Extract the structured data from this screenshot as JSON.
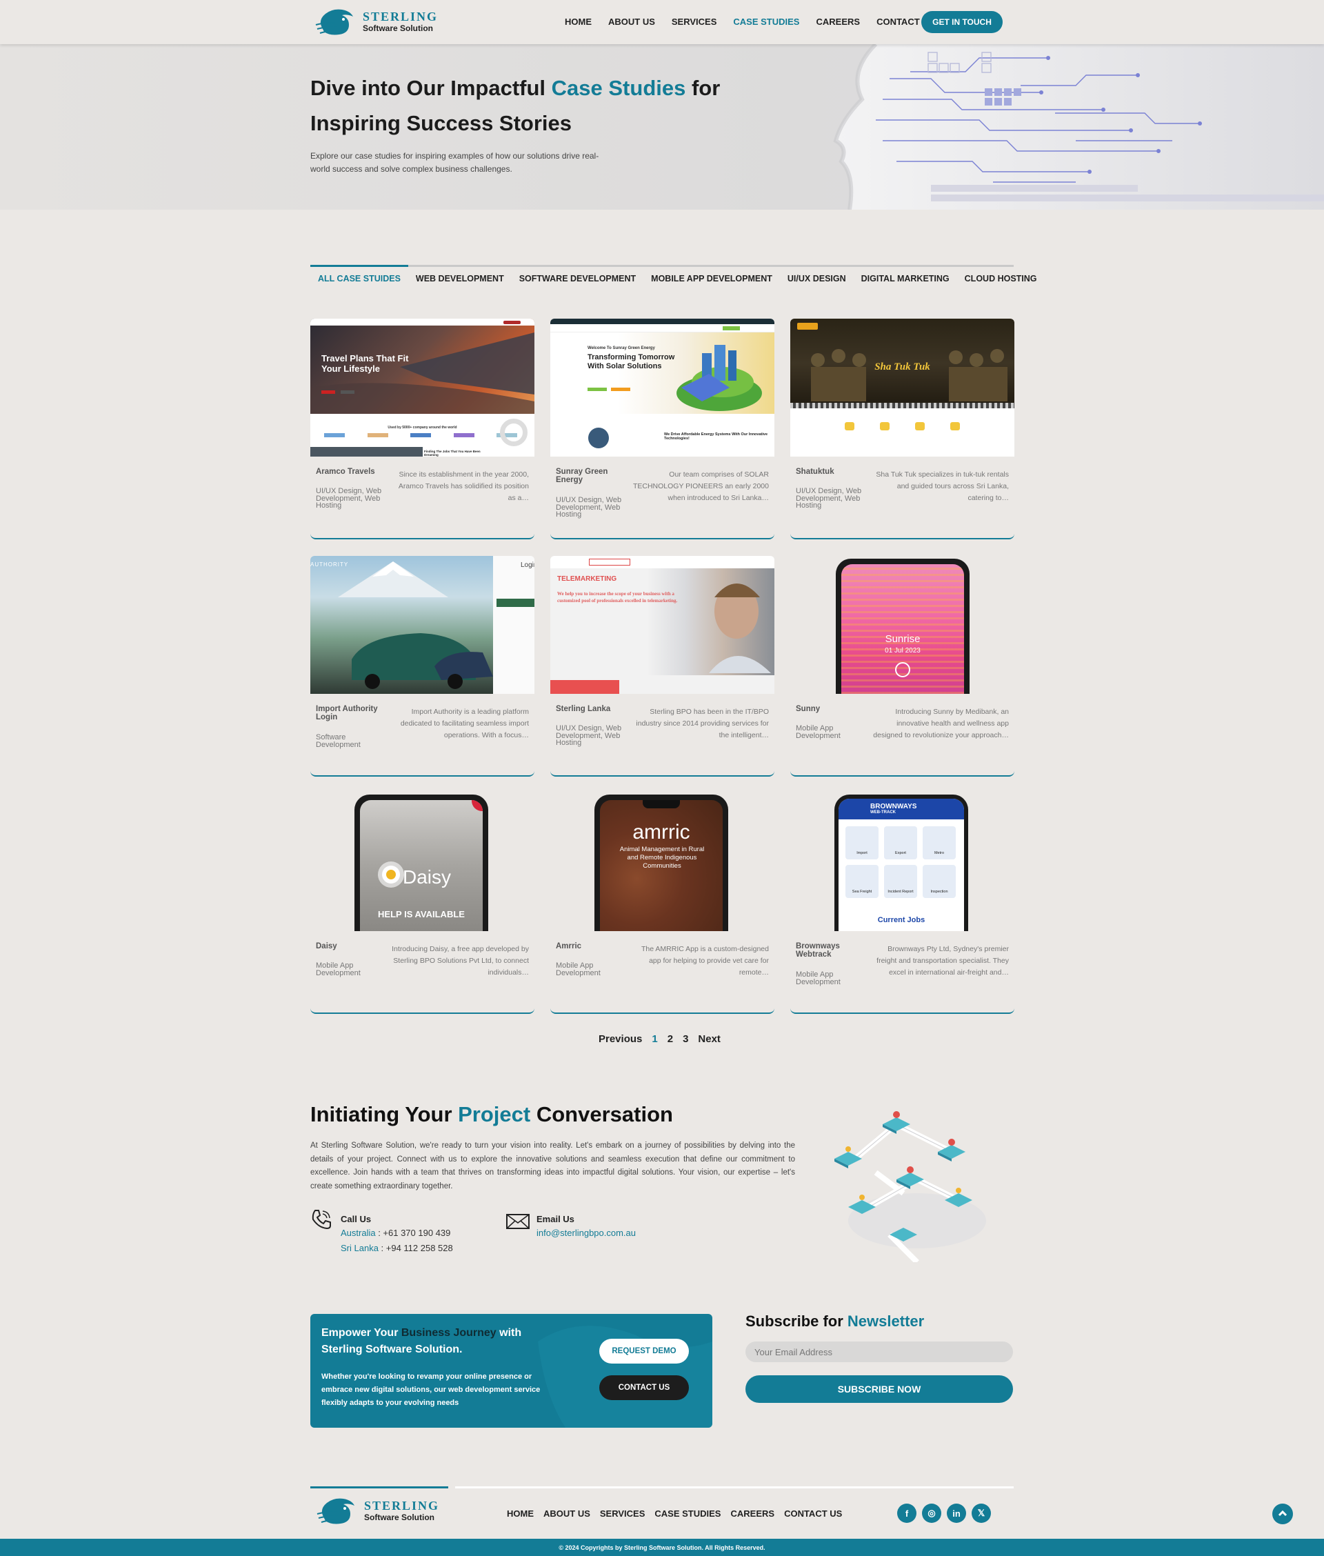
{
  "brand": {
    "name": "STERLING",
    "tagline": "Software Solution"
  },
  "nav": {
    "items": [
      "HOME",
      "ABOUT US",
      "SERVICES",
      "CASE STUDIES",
      "CAREERS",
      "CONTACT US"
    ],
    "active": "CASE STUDIES",
    "cta": "GET IN TOUCH"
  },
  "hero": {
    "title_a": "Dive into Our Impactful ",
    "title_hl": "Case Studies",
    "title_b": " for Inspiring Success Stories",
    "text": "Explore our case studies for inspiring examples of how our solutions drive real-world success and solve complex business challenges."
  },
  "tabs": [
    "ALL CASE STUIDES",
    "WEB DEVELOPMENT",
    "SOFTWARE DEVELOPMENT",
    "MOBILE APP DEVELOPMENT",
    "UI/UX DESIGN",
    "DIGITAL MARKETING",
    "CLOUD HOSTING"
  ],
  "cards": [
    {
      "title": "Aramco Travels",
      "tags": "UI/UX Design, Web Development, Web Hosting",
      "desc": "Since its establishment in the year 2000, Aramco Travels has solidified its position as a…",
      "thumb": {
        "headline": "Travel Plans That Fit Your Lifestyle",
        "sub": "Used by 5000+ company around the world",
        "caption": "Finding The Jobs That You Have Been Dreaming"
      }
    },
    {
      "title": "Sunray Green Energy",
      "tags": "UI/UX Design, Web Development, Web Hosting",
      "desc": "Our team comprises of SOLAR TECHNOLOGY PIONEERS an early 2000 when introduced to Sri Lanka…",
      "thumb": {
        "welcome": "Welcome To Sunray Green Energy",
        "headline": "Transforming Tomorrow With Solar Solutions",
        "caption": "We Drive Affordable Energy Systems With Our Innovative Technologies!"
      }
    },
    {
      "title": "Shatuktuk",
      "tags": "UI/UX Design, Web Development, Web Hosting",
      "desc": "Sha Tuk Tuk specializes in tuk-tuk rentals and guided tours across Sri Lanka, catering to…",
      "thumb": {
        "headline": "Sha Tuk Tuk"
      }
    },
    {
      "title": "Import Authority Login",
      "tags": "Software Development",
      "desc": "Import Authority is a leading platform dedicated to facilitating seamless import operations. With a focus…",
      "thumb": {
        "logo": "AUTHORITY",
        "login": "Login"
      }
    },
    {
      "title": "Sterling Lanka",
      "tags": "UI/UX Design, Web Development, Web Hosting",
      "desc": "Sterling BPO has been in the IT/BPO industry since 2014 providing services for the intelligent…",
      "thumb": {
        "headline": "TELEMARKETING",
        "sub": "We help you to increase the scope of your business with a customized pool of professionals excelled in telemarketing."
      }
    },
    {
      "title": "Sunny",
      "tags": "Mobile App Development",
      "desc": "Introducing Sunny by Medibank, an innovative health and wellness app designed to revolutionize your approach…",
      "thumb": {
        "headline": "Sunrise",
        "sub": "01 Jul 2023"
      }
    },
    {
      "title": "Daisy",
      "tags": "Mobile App Development",
      "desc": "Introducing Daisy, a free app developed by Sterling BPO Solutions Pvt Ltd, to connect individuals…",
      "thumb": {
        "headline": "Daisy",
        "sub": "HELP IS AVAILABLE"
      }
    },
    {
      "title": "Amrric",
      "tags": "Mobile App Development",
      "desc": "The AMRRIC App is a custom-designed app for helping to provide vet care for remote…",
      "thumb": {
        "headline": "amrric",
        "sub": "Animal Management in Rural and Remote Indigenous Communities"
      }
    },
    {
      "title": "Brownways Webtrack",
      "tags": "Mobile App Development",
      "desc": "Brownways Pty Ltd, Sydney's premier freight and transportation specialist. They excel in international air-freight and…",
      "thumb": {
        "headline": "BROWNWAYS",
        "sub": "WEB-TRACK",
        "tiles": [
          "Import",
          "Export",
          "Metro",
          "Sea Freight",
          "Incident Report",
          "Inspection"
        ],
        "caption": "Current Jobs"
      }
    }
  ],
  "pager": {
    "prev": "Previous",
    "pages": [
      "1",
      "2",
      "3"
    ],
    "current": "1",
    "next": "Next"
  },
  "project": {
    "title_a": "Initiating Your ",
    "title_hl": "Project",
    "title_b": " Conversation",
    "text": "At Sterling Software Solution, we're ready to turn your vision into reality. Let's embark on a journey of possibilities by delving into the details of your project. Connect with us to explore the innovative solutions and seamless execution that define our commitment to excellence. Join hands with a team that thrives on transforming ideas into impactful digital solutions. Your vision, our expertise – let's create something extraordinary together.",
    "call": {
      "label": "Call Us",
      "au_k": "Australia",
      "au_v": " : +61 370 190 439",
      "sl_k": "Sri Lanka",
      "sl_v": " : +94 112 258 528"
    },
    "email": {
      "label": "Email Us",
      "value": "info@sterlingbpo.com.au"
    }
  },
  "cta": {
    "t1": "Empower Your ",
    "t2": "Business Journey",
    "t3": " with Sterling Software Solution.",
    "text": "Whether you're looking to revamp your online presence or embrace new digital solutions, our web development service flexibly adapts to your evolving needs",
    "demo": "REQUEST DEMO",
    "contact": "CONTACT US"
  },
  "newsletter": {
    "t1": "Subscribe for ",
    "t2": "Newsletter",
    "placeholder": "Your Email Address",
    "button": "SUBSCRIBE NOW"
  },
  "footer": {
    "nav": [
      "HOME",
      "ABOUT US",
      "SERVICES",
      "CASE STUDIES",
      "CAREERS",
      "CONTACT US"
    ],
    "social": [
      "f",
      "◎",
      "in",
      "𝕏"
    ],
    "copyright": "© 2024 Copyrights by Sterling Software Solution. All Rights Reserved."
  },
  "colors": {
    "accent": "#137c96",
    "bg": "#ebe8e5",
    "dark": "#1d1d1d"
  }
}
